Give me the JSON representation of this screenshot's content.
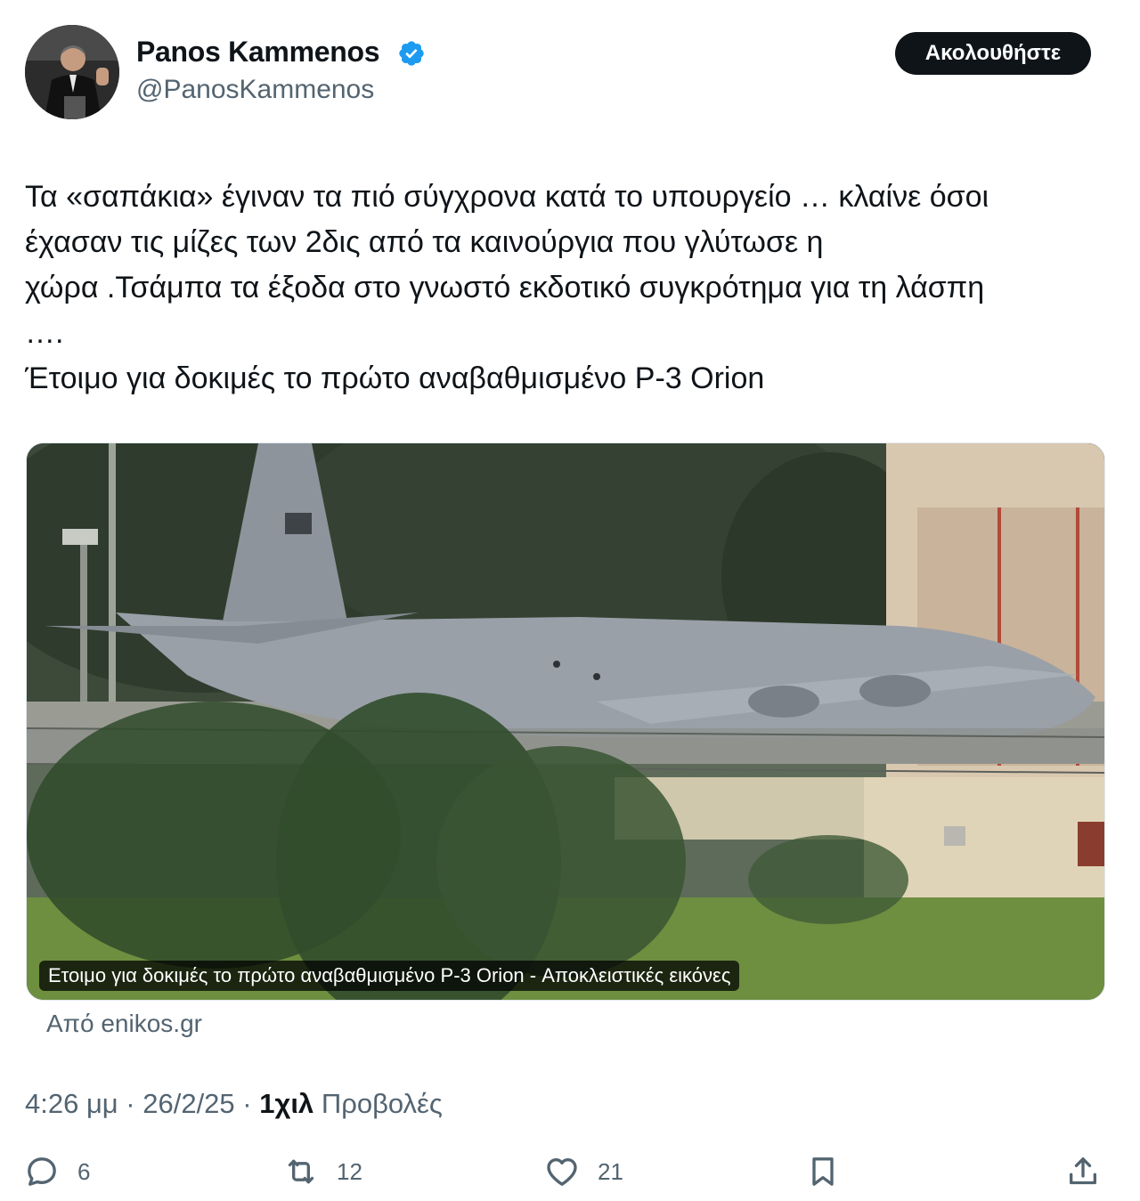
{
  "author": {
    "name": "Panos Kammenos",
    "handle": "@PanosKammenos",
    "verified": true,
    "avatar_icon": "person-at-podium-avatar"
  },
  "follow_label": "Ακολουθήστε",
  "tweet": {
    "lines": [
      "Τα «σαπάκια» έγιναν τα πιό σύγχρονα κατά το υπουργείο … κλαίνε όσοι",
      "έχασαν τις μίζες των 2δις από τα καινούργια που γλύτωσε η",
      "χώρα .Τσάμπα τα έξοδα στο γνωστό εκδοτικό συγκρότημα για τη λάσπη",
      "….",
      "Έτοιμο για δοκιμές το πρώτο αναβαθμισμένο P-3 Orion"
    ]
  },
  "card": {
    "caption": "Ετοιμο για δοκιμές το πρώτο αναβαθμισμένο P-3 Orion - Αποκλειστικές εικόνες",
    "source": "Από enikos.gr",
    "image_icon": "grey-military-aircraft-photo"
  },
  "meta": {
    "time": "4:26 μμ",
    "separator": " · ",
    "date": "26/2/25",
    "views_count": "1χιλ",
    "views_label": "Προβολές"
  },
  "actions": {
    "replies": "6",
    "reposts": "12",
    "likes": "21"
  },
  "colors": {
    "text_primary": "#0f1419",
    "text_secondary": "#536471",
    "verified_blue": "#1d9bf0",
    "follow_bg": "#0f1419"
  }
}
